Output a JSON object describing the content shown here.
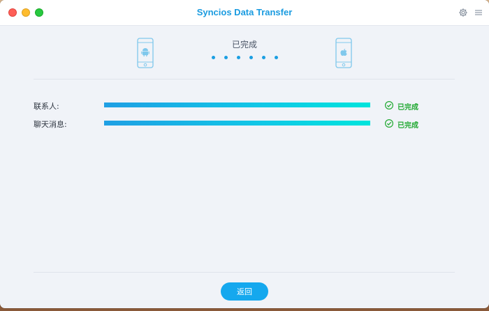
{
  "window": {
    "title": "Syncios Data Transfer"
  },
  "toolbar": {
    "settings_icon": "gear-icon",
    "menu_icon": "hamburger-menu-icon"
  },
  "transfer": {
    "status_text": "已完成",
    "source_icon": "android-phone-icon",
    "target_icon": "apple-phone-icon",
    "dot_count": 6
  },
  "items": [
    {
      "label": "联系人:",
      "progress": 1.0,
      "status": "已完成"
    },
    {
      "label": "聊天消息:",
      "progress": 1.0,
      "status": "已完成"
    }
  ],
  "footer": {
    "back_label": "返回"
  },
  "colors": {
    "accent": "#1b9ee2",
    "success": "#22a933",
    "title": "#1a9be0"
  }
}
